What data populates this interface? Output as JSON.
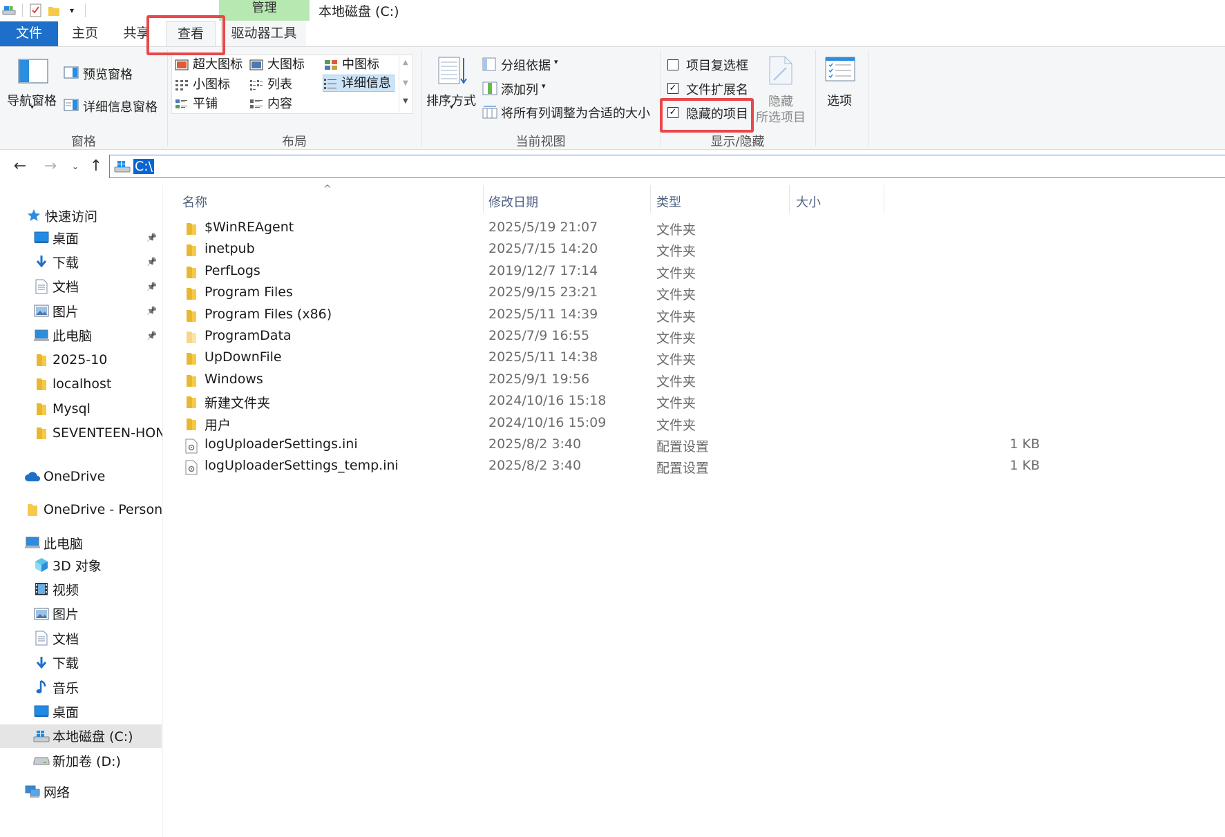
{
  "window": {
    "title": "本地磁盘 (C:)",
    "contextual_tab_group": "管理"
  },
  "ribbon_tabs": {
    "file": "文件",
    "home": "主页",
    "share": "共享",
    "view": "查看",
    "drive_tools": "驱动器工具"
  },
  "ribbon": {
    "panes_group": {
      "label": "窗格",
      "navigation_pane": "导航窗格",
      "preview_pane": "预览窗格",
      "details_pane": "详细信息窗格"
    },
    "layout_group": {
      "label": "布局",
      "extra_large_icons": "超大图标",
      "large_icons": "大图标",
      "medium_icons": "中图标",
      "small_icons": "小图标",
      "list": "列表",
      "details": "详细信息",
      "tiles": "平铺",
      "content": "内容",
      "selected": "详细信息"
    },
    "current_view_group": {
      "label": "当前视图",
      "sort_by": "排序方式",
      "group_by": "分组依据",
      "add_columns": "添加列",
      "size_all_columns": "将所有列调整为合适的大小"
    },
    "show_hide_group": {
      "label": "显示/隐藏",
      "item_check_boxes": {
        "label": "项目复选框",
        "checked": false
      },
      "file_name_extensions": {
        "label": "文件扩展名",
        "checked": true
      },
      "hidden_items": {
        "label": "隐藏的项目",
        "checked": true
      },
      "hide_selected_line1": "隐藏",
      "hide_selected_line2": "所选项目"
    },
    "options": "选项"
  },
  "address_bar": {
    "path": "C:\\"
  },
  "sidebar": {
    "quick_access": "快速访问",
    "quick_items": [
      {
        "label": "桌面",
        "icon": "desktop-icon",
        "pinned": true
      },
      {
        "label": "下载",
        "icon": "download-icon",
        "pinned": true
      },
      {
        "label": "文档",
        "icon": "document-icon",
        "pinned": true
      },
      {
        "label": "图片",
        "icon": "picture-icon",
        "pinned": true
      },
      {
        "label": "此电脑",
        "icon": "computer-icon",
        "pinned": true
      },
      {
        "label": "2025-10",
        "icon": "folder-icon",
        "pinned": false
      },
      {
        "label": "localhost",
        "icon": "folder-icon",
        "pinned": false
      },
      {
        "label": "Mysql",
        "icon": "folder-icon",
        "pinned": false
      },
      {
        "label": "SEVENTEEN-HONOR",
        "icon": "folder-icon",
        "pinned": false
      }
    ],
    "onedrive": "OneDrive",
    "onedrive_personal": "OneDrive - Personal",
    "this_pc": "此电脑",
    "pc_items": [
      {
        "label": "3D 对象",
        "icon": "3d-objects-icon"
      },
      {
        "label": "视频",
        "icon": "video-icon"
      },
      {
        "label": "图片",
        "icon": "picture-icon"
      },
      {
        "label": "文档",
        "icon": "document-icon"
      },
      {
        "label": "下载",
        "icon": "download-icon"
      },
      {
        "label": "音乐",
        "icon": "music-icon"
      },
      {
        "label": "桌面",
        "icon": "desktop-icon"
      },
      {
        "label": "本地磁盘 (C:)",
        "icon": "drive-c-icon",
        "selected": true
      },
      {
        "label": "新加卷 (D:)",
        "icon": "drive-icon"
      }
    ],
    "network": "网络"
  },
  "file_list": {
    "columns": {
      "name": "名称",
      "modified": "修改日期",
      "type": "类型",
      "size": "大小"
    },
    "rows": [
      {
        "name": "$WinREAgent",
        "modified": "2025/5/19 21:07",
        "type": "文件夹",
        "size": "",
        "icon": "folder-icon"
      },
      {
        "name": "inetpub",
        "modified": "2025/7/15 14:20",
        "type": "文件夹",
        "size": "",
        "icon": "folder-icon"
      },
      {
        "name": "PerfLogs",
        "modified": "2019/12/7 17:14",
        "type": "文件夹",
        "size": "",
        "icon": "folder-icon"
      },
      {
        "name": "Program Files",
        "modified": "2025/9/15 23:21",
        "type": "文件夹",
        "size": "",
        "icon": "folder-icon"
      },
      {
        "name": "Program Files (x86)",
        "modified": "2025/5/11 14:39",
        "type": "文件夹",
        "size": "",
        "icon": "folder-icon"
      },
      {
        "name": "ProgramData",
        "modified": "2025/7/9 16:55",
        "type": "文件夹",
        "size": "",
        "icon": "folder-hidden-icon"
      },
      {
        "name": "UpDownFile",
        "modified": "2025/5/11 14:38",
        "type": "文件夹",
        "size": "",
        "icon": "folder-icon"
      },
      {
        "name": "Windows",
        "modified": "2025/9/1 19:56",
        "type": "文件夹",
        "size": "",
        "icon": "folder-icon"
      },
      {
        "name": "新建文件夹",
        "modified": "2024/10/16 15:18",
        "type": "文件夹",
        "size": "",
        "icon": "folder-icon"
      },
      {
        "name": "用户",
        "modified": "2024/10/16 15:09",
        "type": "文件夹",
        "size": "",
        "icon": "folder-icon"
      },
      {
        "name": "logUploaderSettings.ini",
        "modified": "2025/8/2 3:40",
        "type": "配置设置",
        "size": "1 KB",
        "icon": "settings-file-icon"
      },
      {
        "name": "logUploaderSettings_temp.ini",
        "modified": "2025/8/2 3:40",
        "type": "配置设置",
        "size": "1 KB",
        "icon": "settings-file-icon"
      }
    ]
  },
  "colors": {
    "file_tab": "#1e6fc9",
    "contextual_tab": "#b7e8b2",
    "highlight_box": "#e8484a",
    "folder": "#f7c948"
  }
}
